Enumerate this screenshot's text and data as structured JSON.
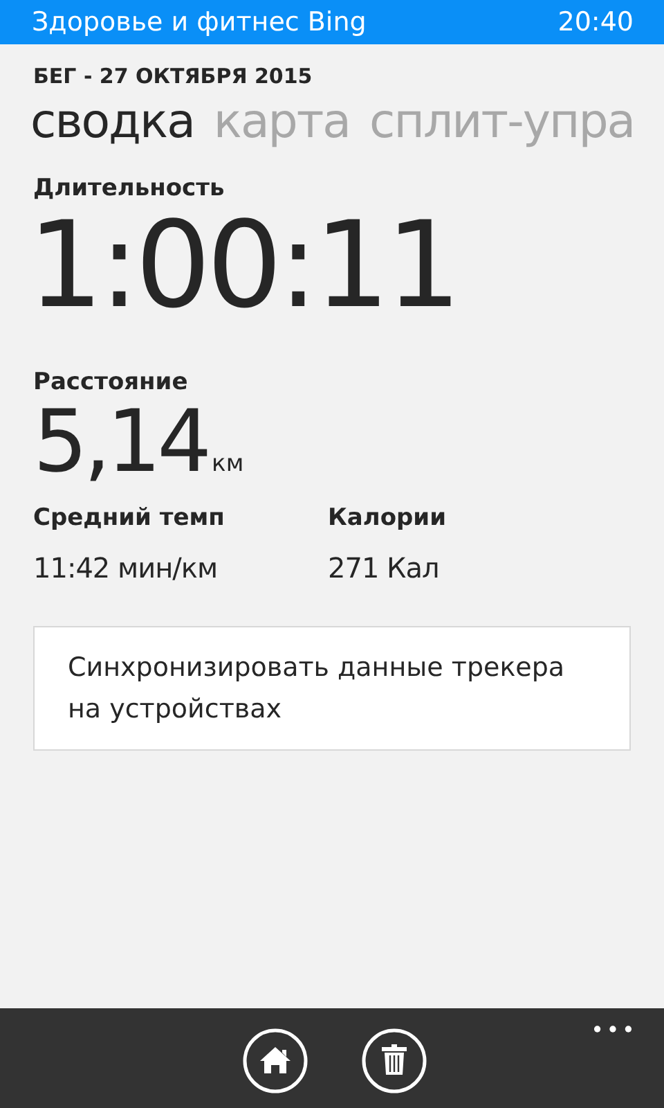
{
  "status_bar": {
    "app_name": "Здоровье и фитнес Bing",
    "time": "20:40"
  },
  "header": "БЕГ - 27 ОКТЯБРЯ 2015",
  "tabs": [
    {
      "label": "сводка",
      "selected": true
    },
    {
      "label": "карта",
      "selected": false
    },
    {
      "label": "сплит-упра",
      "selected": false
    }
  ],
  "duration": {
    "label": "Длительность",
    "value": "1:00:11"
  },
  "distance": {
    "label": "Расстояние",
    "value": "5,14",
    "unit": "км"
  },
  "stats": [
    {
      "label": "Средний темп",
      "value": "11:42 мин/км"
    },
    {
      "label": "Калории",
      "value": "271 Кал"
    }
  ],
  "sync_button": "Синхронизировать данные трекера на устройствах",
  "app_bar": [
    {
      "kind": "home"
    },
    {
      "kind": "delete"
    }
  ]
}
